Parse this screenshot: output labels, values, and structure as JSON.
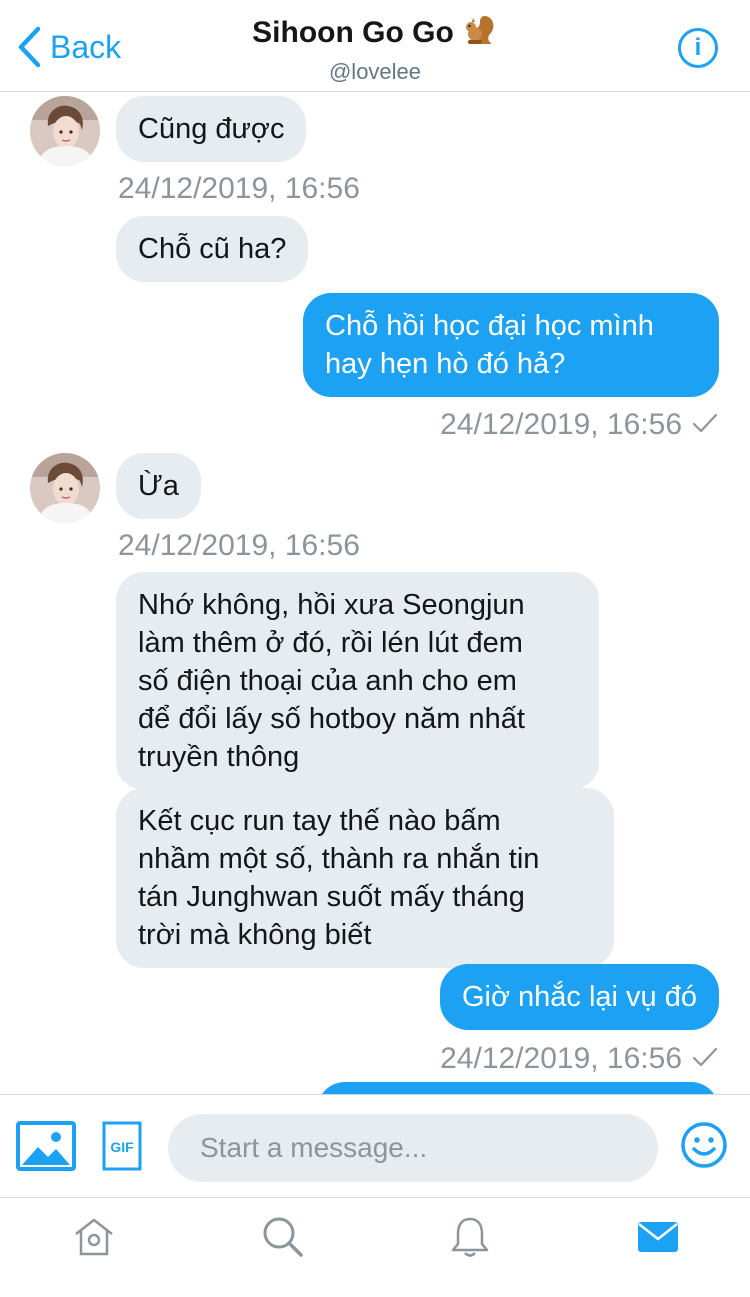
{
  "header": {
    "back_label": "Back",
    "title": "Sihoon Go Go",
    "title_emoji": "🐿",
    "handle": "@lovelee",
    "info_icon": "info-icon"
  },
  "messages": [
    {
      "side": "in",
      "text": "Cũng được"
    },
    {
      "kind": "timestamp",
      "text": "24/12/2019, 16:56"
    },
    {
      "side": "in",
      "text": "Chỗ cũ ha?"
    },
    {
      "side": "out",
      "text": "Chỗ hồi học đại học mình\nhay hẹn hò đó hả?"
    },
    {
      "kind": "timestamp",
      "text": "24/12/2019, 16:56",
      "read": true
    },
    {
      "side": "in",
      "text": "Ừa"
    },
    {
      "kind": "timestamp",
      "text": "24/12/2019, 16:56"
    },
    {
      "side": "in",
      "text": "Nhớ không, hồi xưa Seongjun\nlàm thêm ở đó, rồi lén lút đem\nsố điện thoại của anh cho em\nđể đổi lấy số hotboy năm nhất\ntruyền thông"
    },
    {
      "side": "in",
      "text": "Kết cục run tay thế nào bấm\nnhầm một số, thành ra nhắn tin\ntán Junghwan suốt mấy tháng\ntrời mà không biết"
    },
    {
      "side": "out",
      "text": "Giờ nhắc lại vụ đó"
    },
    {
      "kind": "timestamp",
      "text": "24/12/2019, 16:56",
      "read": true
    }
  ],
  "composer": {
    "placeholder": "Start a message...",
    "media_icon": "image-icon",
    "gif_label": "GIF",
    "emoji_icon": "emoji-icon"
  },
  "tabbar": {
    "items": [
      "home-icon",
      "search-icon",
      "notifications-icon",
      "messages-icon"
    ],
    "active": "messages-icon"
  },
  "colors": {
    "accent": "#1da1f2",
    "incoming_bubble": "#e6ecf0",
    "timestamp": "#8d959c"
  }
}
